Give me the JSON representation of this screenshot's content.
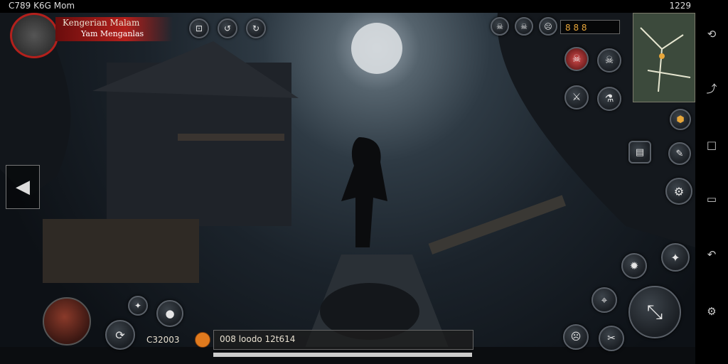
{
  "status_bar": {
    "left": "C789  K6G Mom",
    "right": "1229"
  },
  "player": {
    "name": "Kengerian Malam",
    "subtitle": "Yam Menganlas"
  },
  "resources": {
    "text": "8  8  8"
  },
  "hud": {
    "left_counter": "C32003",
    "mid_counter": "008  loodo 12t614"
  },
  "colors": {
    "health_bar": "#b3201c",
    "moon": "#d8dde0",
    "accent": "#e7a63a"
  },
  "icons": [
    "back-arrow-icon",
    "skull-icon",
    "compass-icon",
    "crosshair-icon",
    "sword-icon",
    "attack-icon"
  ]
}
